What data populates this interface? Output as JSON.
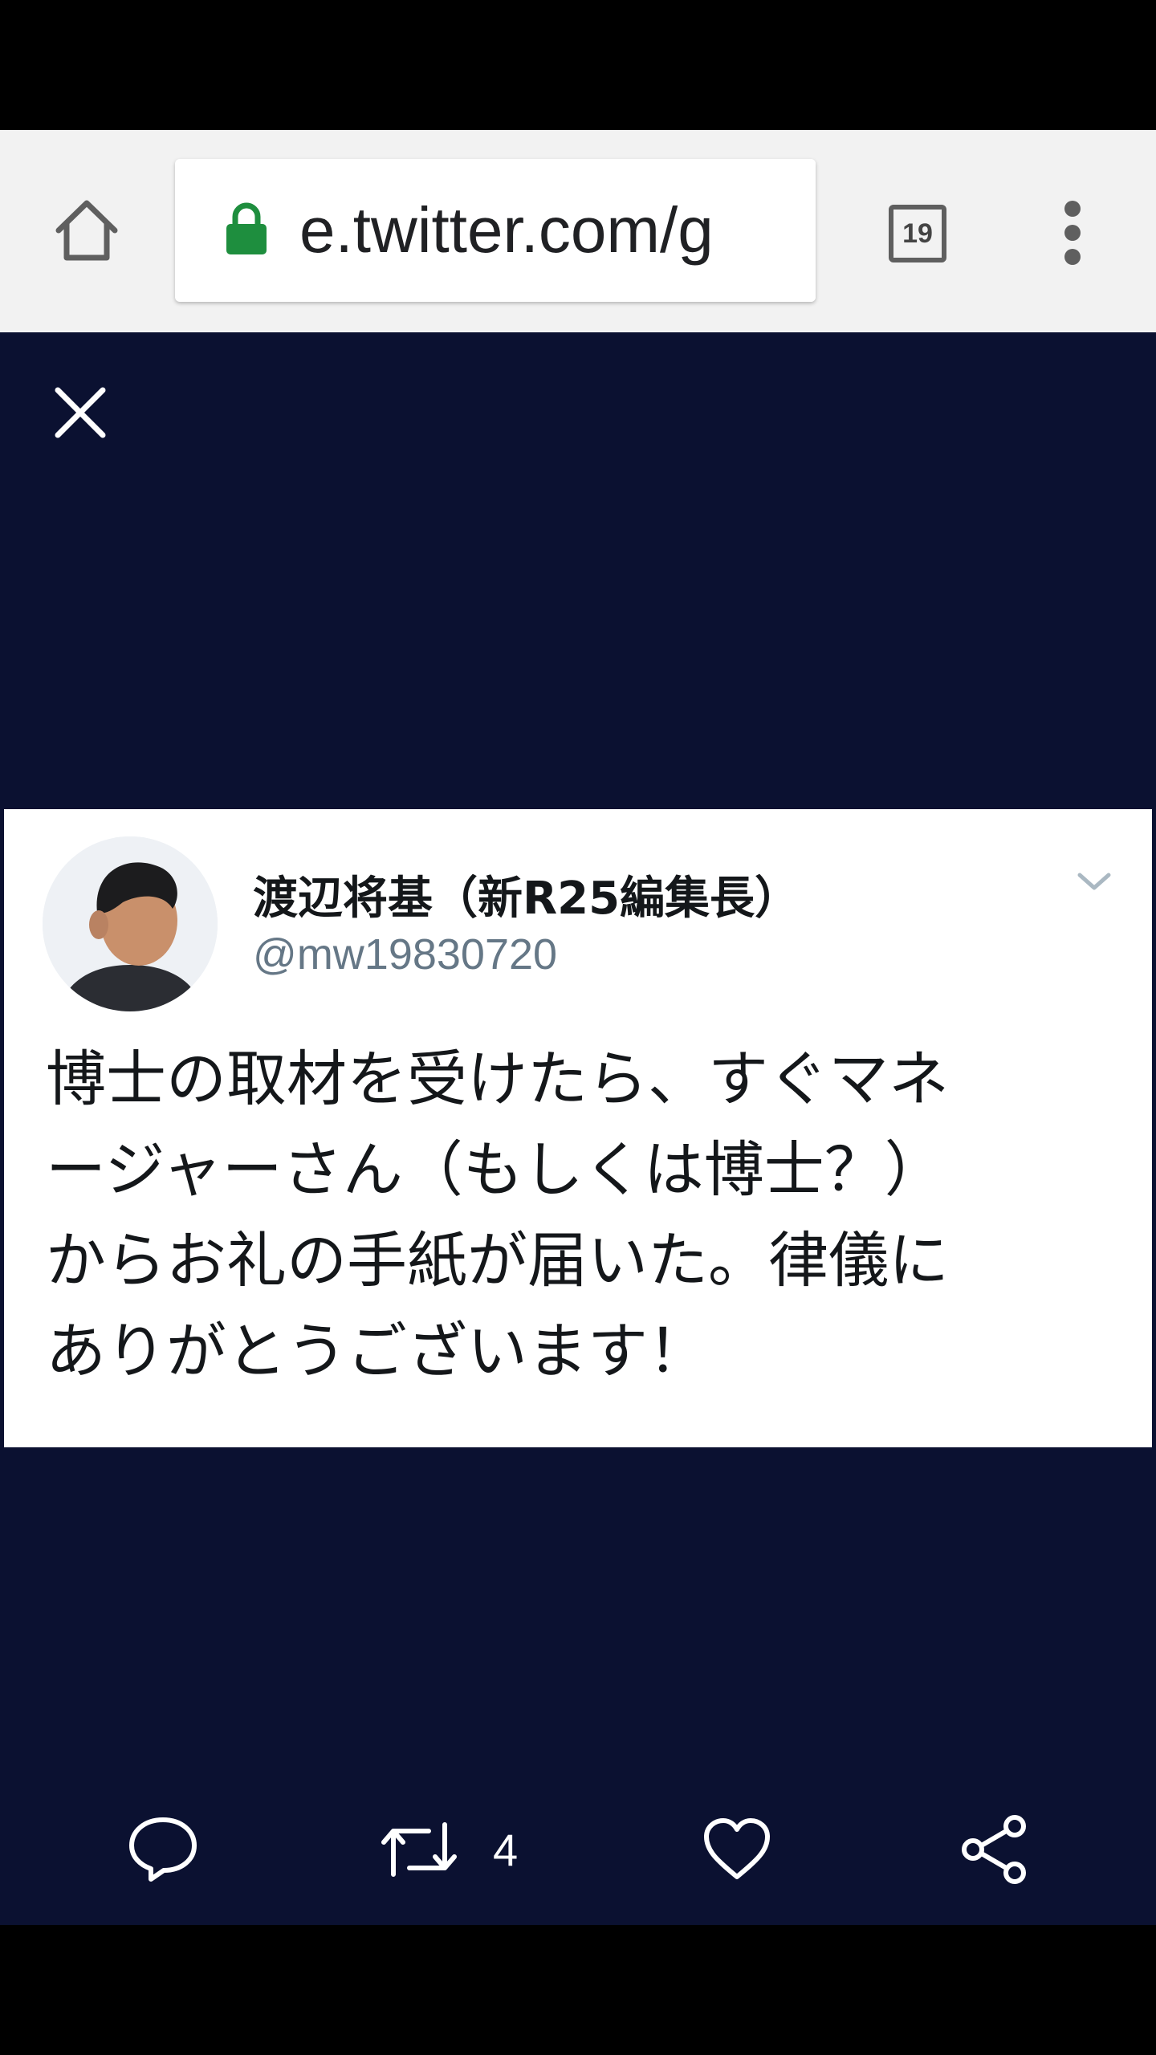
{
  "browser": {
    "url": "e.twitter.com/g",
    "tab_count": "19",
    "icons": {
      "home": "home-icon",
      "lock": "lock-icon",
      "tabs": "tab-switcher-icon",
      "menu": "overflow-menu-icon"
    }
  },
  "viewer": {
    "background": "#0b1131",
    "close_icon": "close-icon"
  },
  "tweet": {
    "display_name": "渡辺将基（新R25編集長）",
    "handle": "@mw19830720",
    "text_lines": [
      "博士の取材を受けたら、すぐマネ",
      "ージャーさん（もしくは博士？）",
      "からお礼の手紙が届いた。律儀に",
      "ありがとうございます！"
    ]
  },
  "actions": {
    "reply_icon": "reply-icon",
    "retweet_icon": "retweet-icon",
    "retweet_count": "4",
    "like_icon": "heart-icon",
    "share_icon": "share-icon"
  },
  "colors": {
    "secure_lock": "#1e8e3e",
    "viewer_bg": "#0b1131",
    "handle": "#657786"
  }
}
